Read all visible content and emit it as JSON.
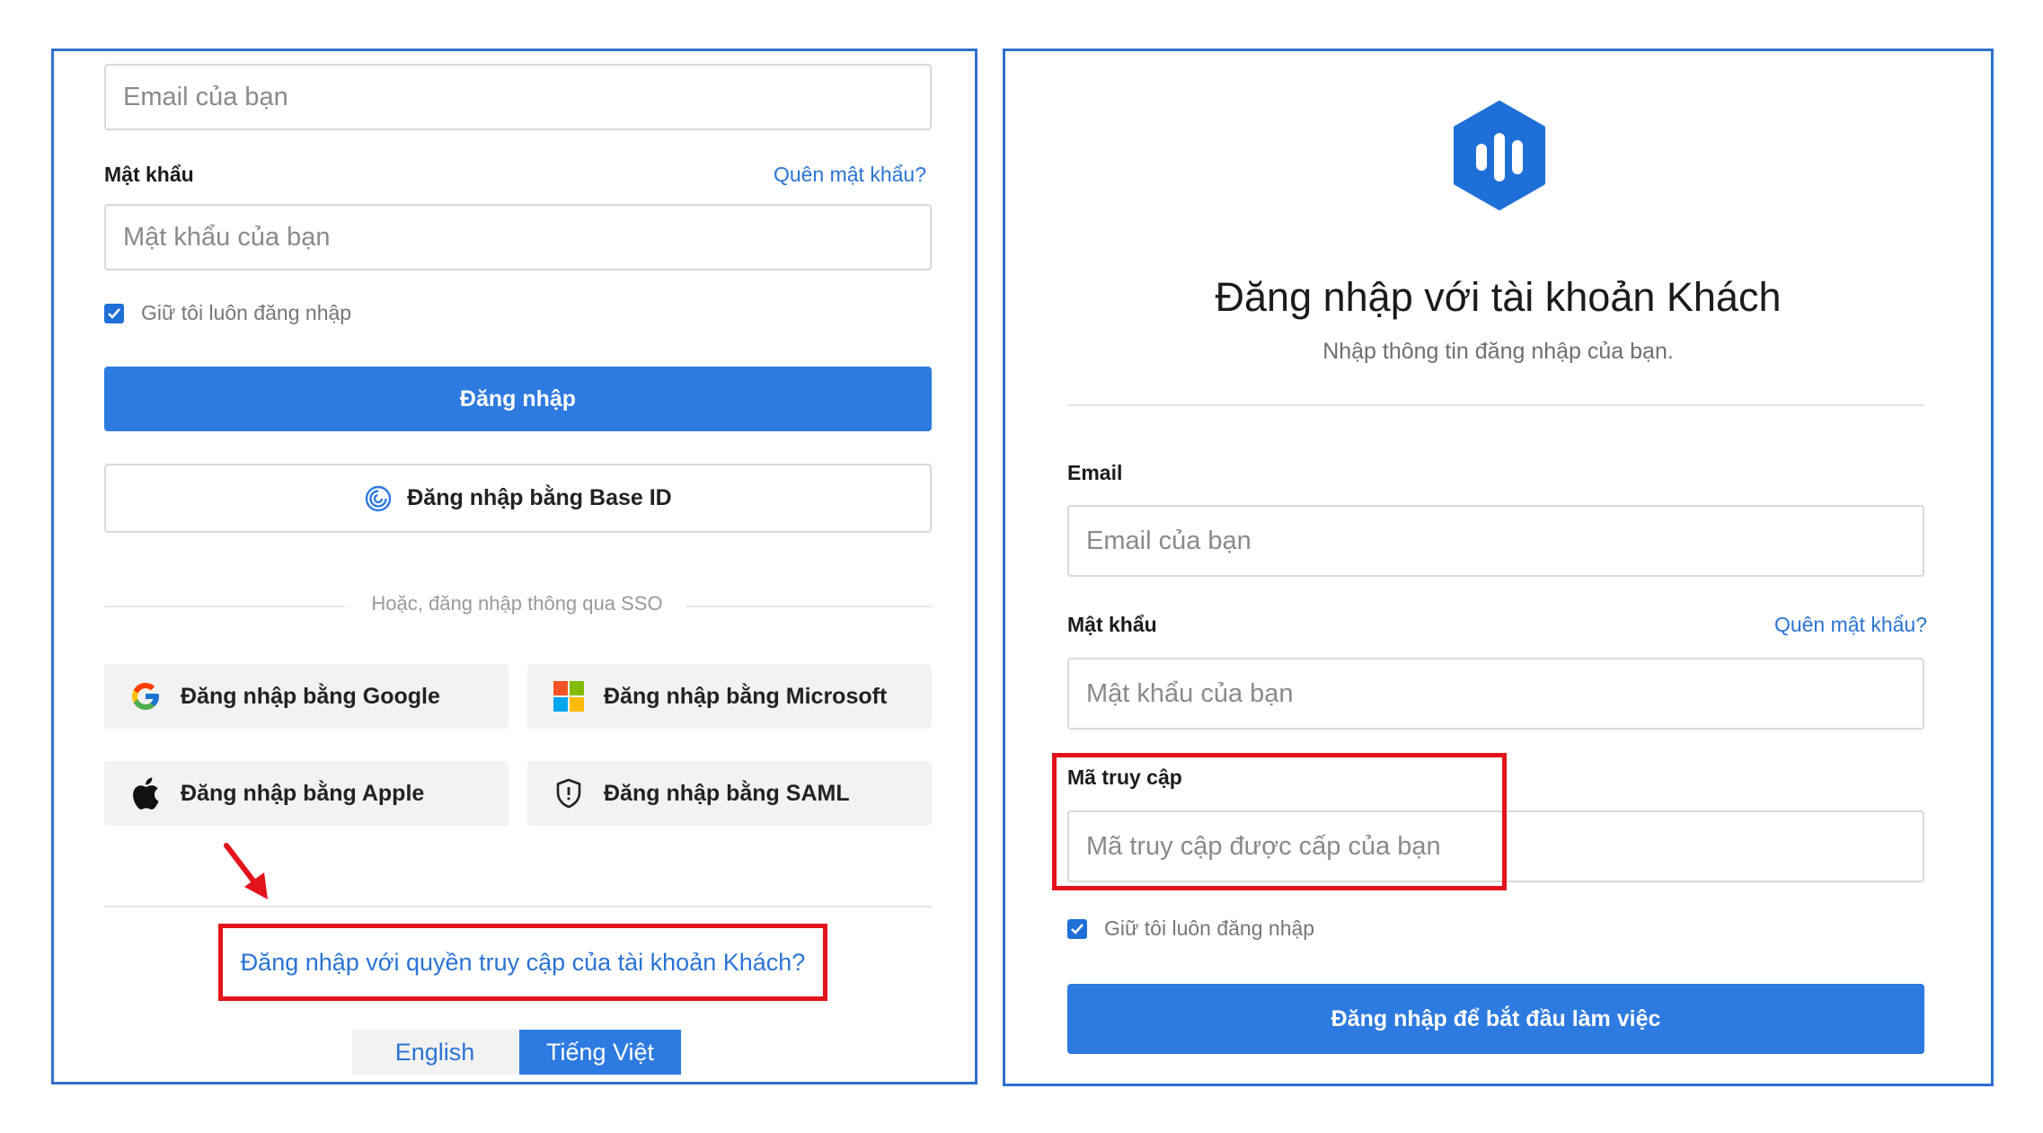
{
  "left": {
    "email_placeholder": "Email của bạn",
    "password_label": "Mật khẩu",
    "forgot_link": "Quên mật khẩu?",
    "password_placeholder": "Mật khẩu của bạn",
    "remember_label": "Giữ tôi luôn đăng nhập",
    "login_button": "Đăng nhập",
    "base_id_button": "Đăng nhập bằng Base ID",
    "sso_divider": "Hoặc, đăng nhập thông qua SSO",
    "sso": {
      "google": "Đăng nhập bằng Google",
      "microsoft": "Đăng nhập bằng Microsoft",
      "apple": "Đăng nhập bằng Apple",
      "saml": "Đăng nhập bằng SAML"
    },
    "guest_link": "Đăng nhập với quyền truy cập của tài khoản Khách?",
    "languages": {
      "english": "English",
      "vietnamese": "Tiếng Việt",
      "selected": "Tiếng Việt"
    }
  },
  "right": {
    "title": "Đăng nhập với tài khoản Khách",
    "subtitle": "Nhập thông tin đăng nhập của bạn.",
    "email_label": "Email",
    "email_placeholder": "Email của bạn",
    "password_label": "Mật khẩu",
    "forgot_link": "Quên mật khẩu?",
    "password_placeholder": "Mật khẩu của bạn",
    "access_code_label": "Mã truy cập",
    "access_code_placeholder": "Mã truy cập được cấp của bạn",
    "remember_label": "Giữ tôi luôn đăng nhập",
    "submit_button": "Đăng nhập để bắt đầu làm việc"
  },
  "colors": {
    "primary": "#2d7ae0",
    "panel_border": "#2f6fcf",
    "highlight": "#e3131b",
    "link": "#2a74d6"
  },
  "icons": {
    "base_id": "fingerprint-icon",
    "google": "google-logo-icon",
    "microsoft": "microsoft-logo-icon",
    "apple": "apple-logo-icon",
    "saml": "shield-icon",
    "brand": "base-logo-icon",
    "annotation": "red-arrow-icon"
  }
}
